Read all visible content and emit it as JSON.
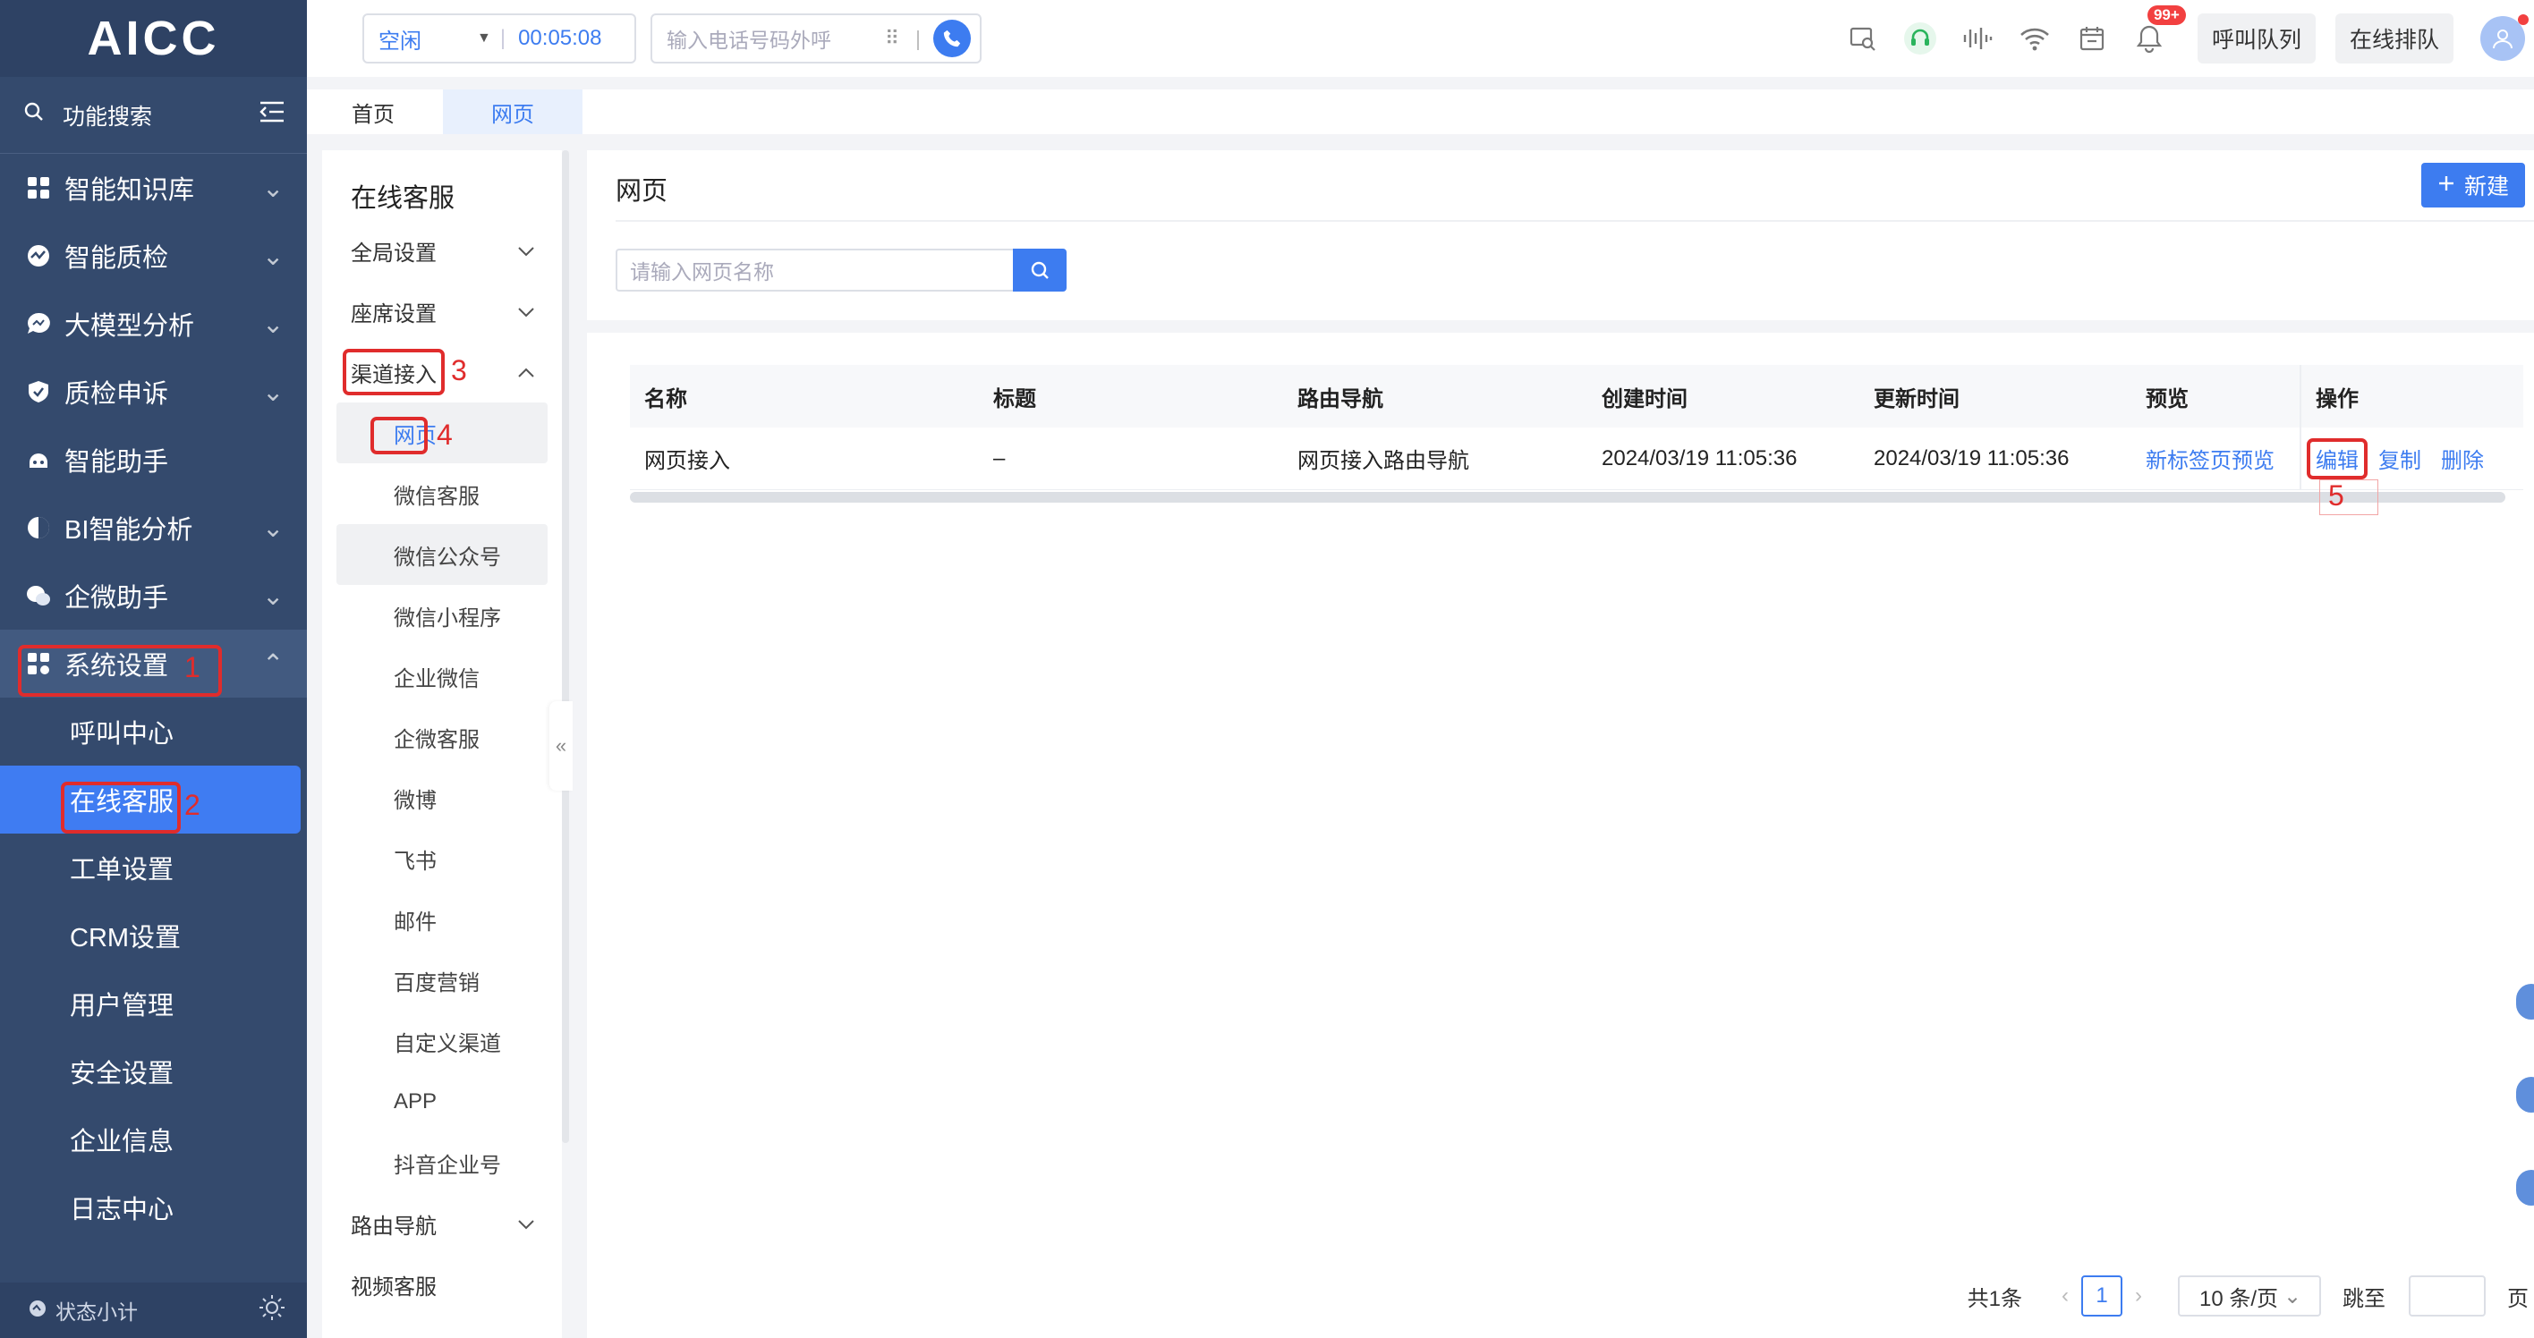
{
  "app": {
    "logo": "AICC"
  },
  "sidebar": {
    "search_label": "功能搜索",
    "menu": [
      {
        "label": "智能知识库",
        "icon": "grid-icon"
      },
      {
        "label": "智能质检",
        "icon": "quality-icon"
      },
      {
        "label": "大模型分析",
        "icon": "chat-icon"
      },
      {
        "label": "质检申诉",
        "icon": "shield-icon"
      },
      {
        "label": "智能助手",
        "icon": "bot-icon"
      },
      {
        "label": "BI智能分析",
        "icon": "pie-icon"
      },
      {
        "label": "企微助手",
        "icon": "wechat-work-icon"
      },
      {
        "label": "系统设置",
        "icon": "settings-grid-icon"
      }
    ],
    "system_sub": [
      {
        "label": "呼叫中心"
      },
      {
        "label": "在线客服"
      },
      {
        "label": "工单设置"
      },
      {
        "label": "CRM设置"
      },
      {
        "label": "用户管理"
      },
      {
        "label": "安全设置"
      },
      {
        "label": "企业信息"
      },
      {
        "label": "日志中心"
      }
    ],
    "footer_label": "状态小计"
  },
  "topbar": {
    "status": "空闲",
    "timer": "00:05:08",
    "dial_placeholder": "输入电话号码外呼",
    "bell_badge": "99+",
    "btn_queue": "呼叫队列",
    "btn_online_queue": "在线排队"
  },
  "tabs": [
    {
      "label": "首页"
    },
    {
      "label": "网页"
    }
  ],
  "submenu": {
    "title": "在线客服",
    "items_before": [
      {
        "label": "全局设置"
      },
      {
        "label": "座席设置"
      },
      {
        "label": "渠道接入"
      }
    ],
    "channel_children": [
      {
        "label": "网页"
      },
      {
        "label": "微信客服"
      },
      {
        "label": "微信公众号"
      },
      {
        "label": "微信小程序"
      },
      {
        "label": "企业微信"
      },
      {
        "label": "企微客服"
      },
      {
        "label": "微博"
      },
      {
        "label": "飞书"
      },
      {
        "label": "邮件"
      },
      {
        "label": "百度营销"
      },
      {
        "label": "自定义渠道"
      },
      {
        "label": "APP"
      },
      {
        "label": "抖音企业号"
      }
    ],
    "items_after": [
      {
        "label": "路由导航"
      },
      {
        "label": "视频客服"
      }
    ]
  },
  "main": {
    "title": "网页",
    "new_button": "新建",
    "search_placeholder": "请输入网页名称",
    "table": {
      "headers": [
        "名称",
        "标题",
        "路由导航",
        "创建时间",
        "更新时间",
        "预览",
        "操作"
      ],
      "rows": [
        {
          "name": "网页接入",
          "title": "–",
          "route": "网页接入路由导航",
          "created": "2024/03/19 11:05:36",
          "updated": "2024/03/19 11:05:36",
          "preview": "新标签页预览",
          "ops": [
            "编辑",
            "复制",
            "删除"
          ]
        }
      ]
    },
    "pagination": {
      "total": "共1条",
      "current_page": "1",
      "page_size": "10 条/页",
      "jump_label": "跳至",
      "page_unit": "页"
    }
  },
  "annotations": [
    "1",
    "2",
    "3",
    "4",
    "5"
  ],
  "colors": {
    "sidebar": "#344a6d",
    "accent": "#3d7cf0",
    "annotation": "#e02c2c"
  }
}
